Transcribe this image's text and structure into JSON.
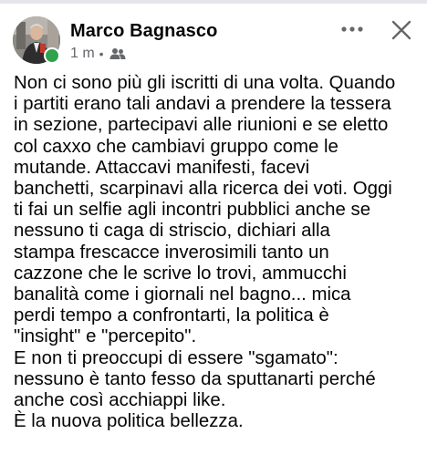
{
  "post": {
    "author": "Marco Bagnasco",
    "time": "1 m",
    "separator": "•",
    "audience_icon": "friends-icon",
    "more_icon": "more-options-icon",
    "close_icon": "close-icon",
    "online_color": "#31a24c",
    "text_lines": [
      "Non ci sono più gli iscritti di una volta. Quando",
      "i partiti erano tali andavi a prendere la tessera",
      "in sezione, partecipavi alle riunioni e se eletto",
      "col caxxo che cambiavi gruppo come le",
      "mutande. Attaccavi manifesti, facevi",
      "banchetti, scarpinavi alla ricerca dei voti. Oggi",
      "ti fai un selfie agli incontri pubblici anche se",
      "nessuno ti caga di striscio, dichiari alla",
      "stampa frescacce inverosimili tanto un",
      "cazzone che le scrive lo trovi, ammucchi",
      "banalità come i giornali nel bagno... mica",
      "perdi tempo a confrontarti, la politica è",
      "\"insight\" e \"percepito\".",
      "E non ti preoccupi di essere \"sgamato\":",
      "nessuno è tanto fesso da sputtanarti perché",
      "anche così acchiappi like.",
      "È la nuova politica bellezza."
    ]
  }
}
